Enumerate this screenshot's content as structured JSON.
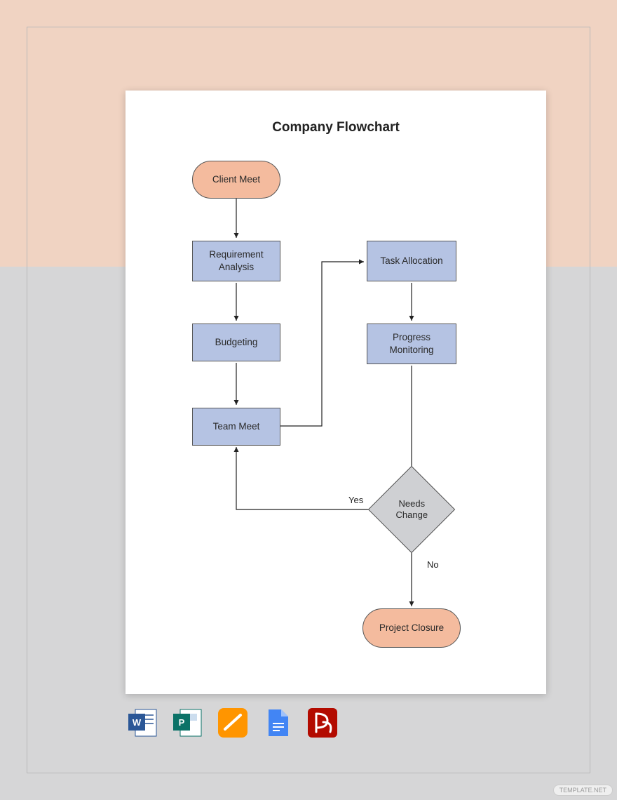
{
  "title": "Company Flowchart",
  "nodes": {
    "start": "Client Meet",
    "req": "Requirement Analysis",
    "budget": "Budgeting",
    "team": "Team Meet",
    "task": "Task Allocation",
    "progress": "Progress Monitoring",
    "decision": "Needs Change",
    "end": "Project Closure"
  },
  "labels": {
    "yes": "Yes",
    "no": "No"
  },
  "watermark": "TEMPLATE.NET",
  "colors": {
    "terminator": "#f4bb9e",
    "process": "#b5c3e3",
    "decision": "#cfd0d3"
  }
}
